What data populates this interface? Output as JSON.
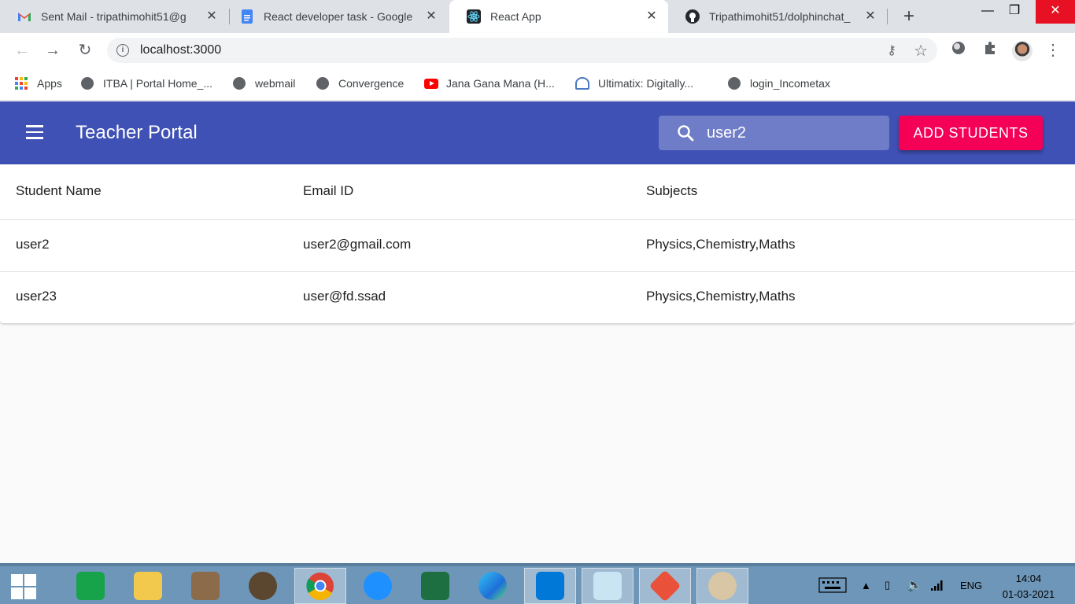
{
  "browser": {
    "tabs": [
      {
        "title": "Sent Mail - tripathimohit51@g",
        "icon": "gmail-icon"
      },
      {
        "title": "React developer task - Google",
        "icon": "google-docs-icon"
      },
      {
        "title": "React App",
        "icon": "react-icon"
      },
      {
        "title": "Tripathimohit51/dolphinchat_",
        "icon": "github-icon"
      }
    ],
    "url": "localhost:3000",
    "bookmarks": [
      {
        "label": "Apps"
      },
      {
        "label": "ITBA | Portal Home_..."
      },
      {
        "label": "webmail"
      },
      {
        "label": "Convergence"
      },
      {
        "label": "Jana Gana Mana (H..."
      },
      {
        "label": "Ultimatix: Digitally..."
      },
      {
        "label": "login_Incometax"
      }
    ]
  },
  "app": {
    "title": "Teacher Portal",
    "search_value": "user2",
    "add_button": "ADD STUDENTS",
    "primary_color": "#3f51b5",
    "accent_color": "#f50057"
  },
  "table": {
    "headers": [
      "Student Name",
      "Email ID",
      "Subjects"
    ],
    "rows": [
      [
        "user2",
        "user2@gmail.com",
        "Physics,Chemistry,Maths"
      ],
      [
        "user23",
        "user@fd.ssad",
        "Physics,Chemistry,Maths"
      ]
    ]
  },
  "taskbar": {
    "language": "ENG",
    "time": "14:04",
    "date": "01-03-2021"
  }
}
